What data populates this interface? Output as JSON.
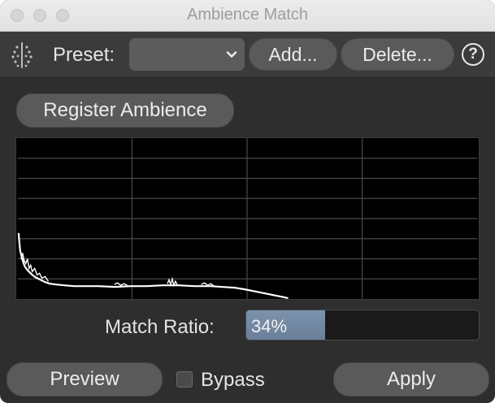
{
  "window": {
    "title": "Ambience Match"
  },
  "toolbar": {
    "preset_label": "Preset:",
    "preset_value": "",
    "add_label": "Add...",
    "delete_label": "Delete...",
    "help_glyph": "?"
  },
  "register_button_label": "Register Ambience",
  "match_ratio": {
    "label": "Match Ratio:",
    "value_text": "34%",
    "value": 34
  },
  "footer": {
    "preview_label": "Preview",
    "bypass_label": "Bypass",
    "bypass_checked": false,
    "apply_label": "Apply"
  },
  "colors": {
    "window_bg": "#2e2e2e",
    "toolbar_bg": "#3b3b3b",
    "button_bg": "#5a5a5a",
    "progress_fill": "#7488a2",
    "graph_bg": "#000000",
    "graph_grid": "#4a4a4a",
    "spectrum": "#ffffff"
  },
  "icons": {
    "logo": "waveform-dots-icon",
    "dropdown": "chevron-down-icon",
    "help": "question-circle-icon"
  }
}
